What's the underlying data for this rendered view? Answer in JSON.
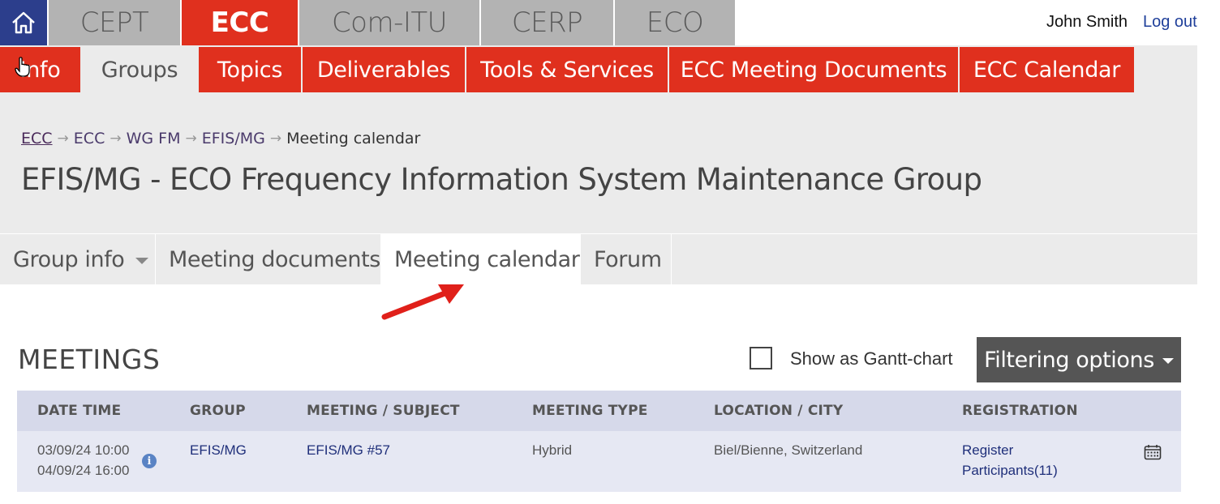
{
  "org_tabs": [
    {
      "label": "CEPT"
    },
    {
      "label": "ECC"
    },
    {
      "label": "Com-ITU"
    },
    {
      "label": "CERP"
    },
    {
      "label": "ECO"
    }
  ],
  "user": {
    "name": "John Smith",
    "logout": "Log out"
  },
  "sub_tabs": [
    {
      "label": "Info"
    },
    {
      "label": "Groups"
    },
    {
      "label": "Topics"
    },
    {
      "label": "Deliverables"
    },
    {
      "label": "Tools & Services"
    },
    {
      "label": "ECC Meeting Documents"
    },
    {
      "label": "ECC Calendar"
    }
  ],
  "breadcrumb": [
    "ECC",
    "ECC",
    "WG FM",
    "EFIS/MG",
    "Meeting calendar"
  ],
  "page_title": "EFIS/MG - ECO Frequency Information System Maintenance Group",
  "group_tabs": [
    {
      "label": "Group info"
    },
    {
      "label": "Meeting documents"
    },
    {
      "label": "Meeting calendar"
    },
    {
      "label": "Forum"
    }
  ],
  "meetings": {
    "title": "MEETINGS",
    "gantt_label": "Show as Gantt-chart",
    "filter_label": "Filtering options",
    "columns": [
      "DATE TIME",
      "GROUP",
      "MEETING / SUBJECT",
      "MEETING TYPE",
      "LOCATION / CITY",
      "REGISTRATION"
    ],
    "rows": [
      {
        "start": "03/09/24 10:00",
        "end": "04/09/24 16:00",
        "group": "EFIS/MG",
        "subject": "EFIS/MG #57",
        "type": "Hybrid",
        "location": "Biel/Bienne, Switzerland",
        "reg_line1": "Register",
        "reg_line2": "Participants(11)"
      }
    ]
  },
  "colors": {
    "accent_red": "#e0301e",
    "home_blue": "#2c3e8c",
    "tab_grey": "#b3b3b3"
  }
}
